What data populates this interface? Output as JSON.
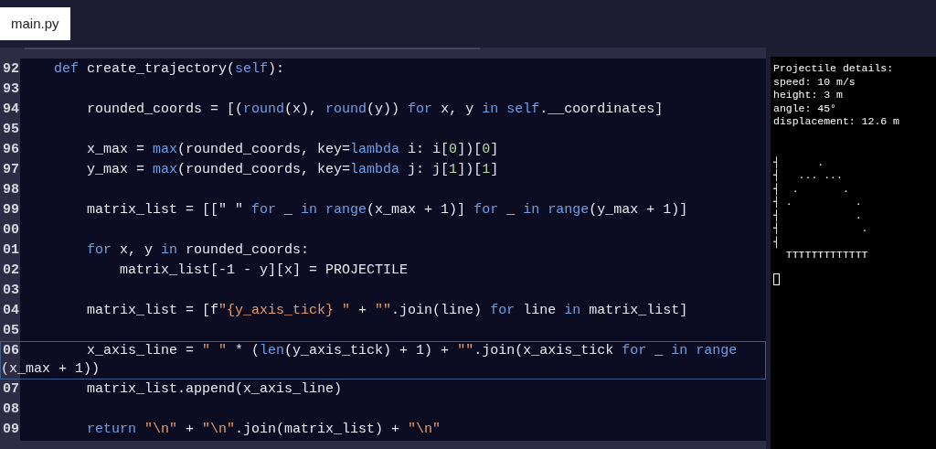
{
  "tabs": [
    {
      "label": "main.py",
      "selected": true
    }
  ],
  "editor": {
    "lines": [
      {
        "number": "92",
        "current": false,
        "tokens": [
          {
            "kind": "kw",
            "text": "    def"
          },
          {
            "kind": "txt",
            "text": " create_trajectory("
          },
          {
            "kind": "kw",
            "text": "self"
          },
          {
            "kind": "txt",
            "text": "):"
          }
        ]
      },
      {
        "number": "93",
        "current": false
      },
      {
        "number": "94",
        "current": false,
        "tokens": [
          {
            "kind": "txt",
            "text": "        rounded_coords = [("
          },
          {
            "kind": "kw",
            "text": "round"
          },
          {
            "kind": "txt",
            "text": "(x), "
          },
          {
            "kind": "kw",
            "text": "round"
          },
          {
            "kind": "txt",
            "text": "(y)) "
          },
          {
            "kind": "kw",
            "text": "for"
          },
          {
            "kind": "txt",
            "text": " x, y "
          },
          {
            "kind": "kw",
            "text": "in self"
          },
          {
            "kind": "txt",
            "text": ".__coordinates]"
          }
        ]
      },
      {
        "number": "95",
        "current": false
      },
      {
        "number": "96",
        "current": false,
        "tokens": [
          {
            "kind": "txt",
            "text": "        x_max = "
          },
          {
            "kind": "kw",
            "text": "max"
          },
          {
            "kind": "txt",
            "text": "(rounded_coords, key="
          },
          {
            "kind": "kw",
            "text": "lambda"
          },
          {
            "kind": "txt",
            "text": " i: i["
          },
          {
            "kind": "num",
            "text": "0"
          },
          {
            "kind": "txt",
            "text": "])["
          },
          {
            "kind": "num",
            "text": "0"
          },
          {
            "kind": "txt",
            "text": "]"
          }
        ]
      },
      {
        "number": "97",
        "current": false,
        "tokens": [
          {
            "kind": "txt",
            "text": "        y_max = "
          },
          {
            "kind": "kw",
            "text": "max"
          },
          {
            "kind": "txt",
            "text": "(rounded_coords, key="
          },
          {
            "kind": "kw",
            "text": "lambda"
          },
          {
            "kind": "txt",
            "text": " j: j["
          },
          {
            "kind": "num",
            "text": "1"
          },
          {
            "kind": "txt",
            "text": "])["
          },
          {
            "kind": "num",
            "text": "1"
          },
          {
            "kind": "txt",
            "text": "]"
          }
        ]
      },
      {
        "number": "98",
        "current": false
      },
      {
        "number": "99",
        "current": false,
        "tokens": [
          {
            "kind": "txt",
            "text": "        matrix_list = [[\" \" "
          },
          {
            "kind": "kw",
            "text": "for"
          },
          {
            "kind": "txt",
            "text": " _ "
          },
          {
            "kind": "kw",
            "text": "in range"
          },
          {
            "kind": "txt",
            "text": "(x_max + 1)] "
          },
          {
            "kind": "kw",
            "text": "for"
          },
          {
            "kind": "txt",
            "text": " _ "
          },
          {
            "kind": "kw",
            "text": "in range"
          },
          {
            "kind": "txt",
            "text": "(y_max + 1)]"
          }
        ]
      },
      {
        "number": "00",
        "current": false
      },
      {
        "number": "01",
        "current": false,
        "tokens": [
          {
            "kind": "kw",
            "text": "        for"
          },
          {
            "kind": "txt",
            "text": " x, y "
          },
          {
            "kind": "kw",
            "text": "in"
          },
          {
            "kind": "txt",
            "text": " rounded_coords:"
          }
        ]
      },
      {
        "number": "02",
        "current": false,
        "tokens": [
          {
            "kind": "txt",
            "text": "            matrix_list[-1 - y][x] = PROJECTILE"
          }
        ]
      },
      {
        "number": "03",
        "current": false
      },
      {
        "number": "04",
        "current": false,
        "tokens": [
          {
            "kind": "txt",
            "text": "        matrix_list = [f"
          },
          {
            "kind": "str",
            "text": "\"{y_axis_tick} \""
          },
          {
            "kind": "txt",
            "text": " + "
          },
          {
            "kind": "str",
            "text": "\"\""
          },
          {
            "kind": "txt",
            "text": ".join(line) "
          },
          {
            "kind": "kw",
            "text": "for"
          },
          {
            "kind": "txt",
            "text": " line "
          },
          {
            "kind": "kw",
            "text": "in"
          },
          {
            "kind": "txt",
            "text": " matrix_list]"
          }
        ]
      },
      {
        "number": "05",
        "current": false
      },
      {
        "number": "06",
        "current": true,
        "tokens": [
          {
            "kind": "txt",
            "text": "        x_axis_line = "
          },
          {
            "kind": "str",
            "text": "\" \""
          },
          {
            "kind": "txt",
            "text": " * ("
          },
          {
            "kind": "kw",
            "text": "len"
          },
          {
            "kind": "txt",
            "text": "(y_axis_tick) + 1) + "
          },
          {
            "kind": "str",
            "text": "\"\""
          },
          {
            "kind": "txt",
            "text": ".join(x_axis_tick "
          },
          {
            "kind": "kw",
            "text": "for"
          },
          {
            "kind": "txt",
            "text": " _ "
          },
          {
            "kind": "kw",
            "text": "in range"
          }
        ],
        "wrap": [
          {
            "kind": "txt",
            "text": "(x_max + 1))"
          }
        ]
      },
      {
        "number": "07",
        "current": false,
        "tokens": [
          {
            "kind": "txt",
            "text": "        matrix_list.append(x_axis_line)"
          }
        ]
      },
      {
        "number": "08",
        "current": false
      },
      {
        "number": "09",
        "current": false,
        "tokens": [
          {
            "kind": "kw",
            "text": "        return "
          },
          {
            "kind": "str",
            "text": "\"\\n\""
          },
          {
            "kind": "txt",
            "text": " + "
          },
          {
            "kind": "str",
            "text": "\"\\n\""
          },
          {
            "kind": "txt",
            "text": ".join(matrix_list) + "
          },
          {
            "kind": "str",
            "text": "\"\\n\""
          }
        ]
      }
    ]
  },
  "terminal": {
    "lines": [
      "Projectile details:",
      "speed: 10 m/s",
      "height: 3 m",
      "angle: 45°",
      "displacement: 12.6 m"
    ],
    "plot": [
      "┤      .",
      "┤   ... ...",
      "┤  .       .",
      "┤ .          .",
      "┤            .",
      "┤             .",
      "┤",
      "  TTTTTTTTTTTTT"
    ]
  }
}
